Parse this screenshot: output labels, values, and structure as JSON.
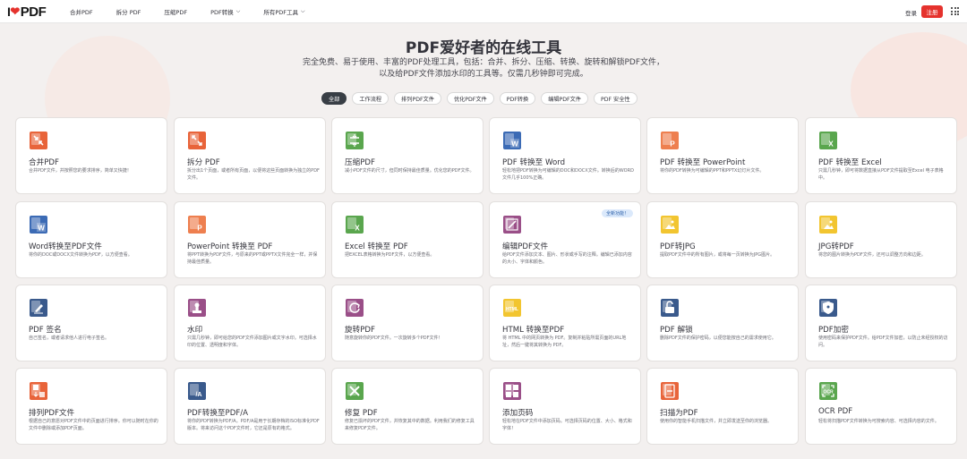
{
  "header": {
    "logo_text": "PDF",
    "nav": [
      {
        "label": "合并PDF",
        "dropdown": false
      },
      {
        "label": "拆分 PDF",
        "dropdown": false
      },
      {
        "label": "压缩PDF",
        "dropdown": false
      },
      {
        "label": "PDF转换",
        "dropdown": true
      },
      {
        "label": "所有PDF工具",
        "dropdown": true
      }
    ],
    "login": "登录",
    "signup": "注册"
  },
  "hero": {
    "title": "PDF爱好者的在线工具",
    "subtitle": "完全免费、易于使用、丰富的PDF处理工具，包括：合并、拆分、压缩、转换、旋转和解锁PDF文件，以及给PDF文件添加水印的工具等。仅需几秒钟即可完成。"
  },
  "tabs": [
    "全部",
    "工作流程",
    "排列PDF文件",
    "优化PDF文件",
    "PDF转换",
    "编辑PDF文件",
    "PDF 安全性"
  ],
  "colors": {
    "accent": "#e5322d",
    "orange": "#e8643a",
    "green": "#5aa64e",
    "blue": "#3c6bb5",
    "pdf_orange": "#ee7f4f",
    "purple": "#9a4f88",
    "yellow": "#f2c530",
    "navy": "#3a5a8c"
  },
  "cards": [
    {
      "title": "合并PDF",
      "desc": "合并PDF文件，并按照您的要求排序，简单又快捷！",
      "icon": "merge-icon",
      "color": "#e8643a"
    },
    {
      "title": "拆分 PDF",
      "desc": "拆分出1个页面，或者所有页面，以便将这些页面转换为独立的PDF文件。",
      "icon": "split-icon",
      "color": "#e8643a"
    },
    {
      "title": "压缩PDF",
      "desc": "减小PDF文件的尺寸，但同时保持最佳质量。优化您的PDF文件。",
      "icon": "compress-icon",
      "color": "#5aa64e"
    },
    {
      "title": "PDF 转换至 Word",
      "desc": "轻松地把PDF转换为可编辑的DOC和DOCX文件。转换后的WORD文件几乎100%正确。",
      "icon": "word-icon",
      "color": "#3c6bb5"
    },
    {
      "title": "PDF 转换至 PowerPoint",
      "desc": "将你的PDF转换为可编辑的PPT和PPTX幻灯片文件。",
      "icon": "powerpoint-icon",
      "color": "#ee7f4f"
    },
    {
      "title": "PDF 转换至 Excel",
      "desc": "只需几秒钟，即可将数据直接从PDF文件提取至Excel 电子表格中。",
      "icon": "excel-icon",
      "color": "#5aa64e"
    },
    {
      "title": "Word转换至PDF文件",
      "desc": "将你的DOC或DOCX文件转换为PDF，以方便查看。",
      "icon": "word-to-pdf-icon",
      "color": "#3c6bb5"
    },
    {
      "title": "PowerPoint 转换至 PDF",
      "desc": "将PPT转换为PDF文件，与原来的PPT或PPTX文件完全一样，并保持最佳质量。",
      "icon": "powerpoint-to-pdf-icon",
      "color": "#ee7f4f"
    },
    {
      "title": "Excel 转换至 PDF",
      "desc": "把EXCEL表格转换为PDF文件，以方便查看。",
      "icon": "excel-to-pdf-icon",
      "color": "#5aa64e"
    },
    {
      "title": "编辑PDF文件",
      "desc": "给PDF文件添加文本、图片、形状或手写的注释。编辑已添加内容的大小、字体和颜色。",
      "icon": "edit-icon",
      "color": "#9a4f88",
      "badge": "全新功能！"
    },
    {
      "title": "PDF转JPG",
      "desc": "提取PDF文件中的所有图片，或将每一页转换为JPG图片。",
      "icon": "pdf-to-jpg-icon",
      "color": "#f2c530"
    },
    {
      "title": "JPG转PDF",
      "desc": "将您的图片转换为PDF文件，还可以调整方向和边距。",
      "icon": "jpg-to-pdf-icon",
      "color": "#f2c530"
    },
    {
      "title": "PDF 签名",
      "desc": "自己签名，或者请求他人进行电子签名。",
      "icon": "sign-icon",
      "color": "#3a5a8c"
    },
    {
      "title": "水印",
      "desc": "只需几秒钟，即可给您的PDF文件添加图片或文字水印。可选择水印的位置、透明度和字体。",
      "icon": "watermark-icon",
      "color": "#9a4f88"
    },
    {
      "title": "旋转PDF",
      "desc": "随意旋转你的PDF文件。一次旋转多个PDF文件！",
      "icon": "rotate-icon",
      "color": "#9a4f88"
    },
    {
      "title": "HTML 转换至PDF",
      "desc": "将 HTML 中的网页转换为 PDF。复制并粘贴所需页面的URL地址，然后一键将其转换为 PDF。",
      "icon": "html-icon",
      "color": "#f2c530"
    },
    {
      "title": "PDF 解锁",
      "desc": "删除PDF文件的保护密码，以便您能按自己的需求使用它。",
      "icon": "unlock-icon",
      "color": "#3a5a8c"
    },
    {
      "title": "PDF加密",
      "desc": "使用密码来保护PDF文件。给PDF文件加密，以防止未经授权的访问。",
      "icon": "protect-icon",
      "color": "#3a5a8c"
    },
    {
      "title": "排列PDF文件",
      "desc": "根据自己的意愿对PDF文件中的页面进行排序。你可以随时在你的文件中删除或添加PDF页面。",
      "icon": "organize-icon",
      "color": "#e8643a"
    },
    {
      "title": "PDF转换至PDF/A",
      "desc": "将你的PDF转换为PDF/A。PDF/A是用于长期存档的ISO标准化PDF版本。将来访问这个PDF文件时，它还是原有的格式。",
      "icon": "pdfa-icon",
      "color": "#3a5a8c"
    },
    {
      "title": "修复 PDF",
      "desc": "修复已损坏的PDF文件，并恢复其中的数据。利用我们的修复工具来修复PDF文件。",
      "icon": "repair-icon",
      "color": "#5aa64e"
    },
    {
      "title": "添加页码",
      "desc": "轻松地在PDF文件中添加页码。可选择页码的位置、大小、格式和字体！",
      "icon": "page-numbers-icon",
      "color": "#9a4f88"
    },
    {
      "title": "扫描为PDF",
      "desc": "使用你的智能手机扫描文件，并立即发送至你的浏览器。",
      "icon": "scan-icon",
      "color": "#e8643a"
    },
    {
      "title": "OCR PDF",
      "desc": "轻松将扫描PDF文件转换为可搜索内容、可选择内容的文件。",
      "icon": "ocr-icon",
      "color": "#5aa64e"
    }
  ]
}
